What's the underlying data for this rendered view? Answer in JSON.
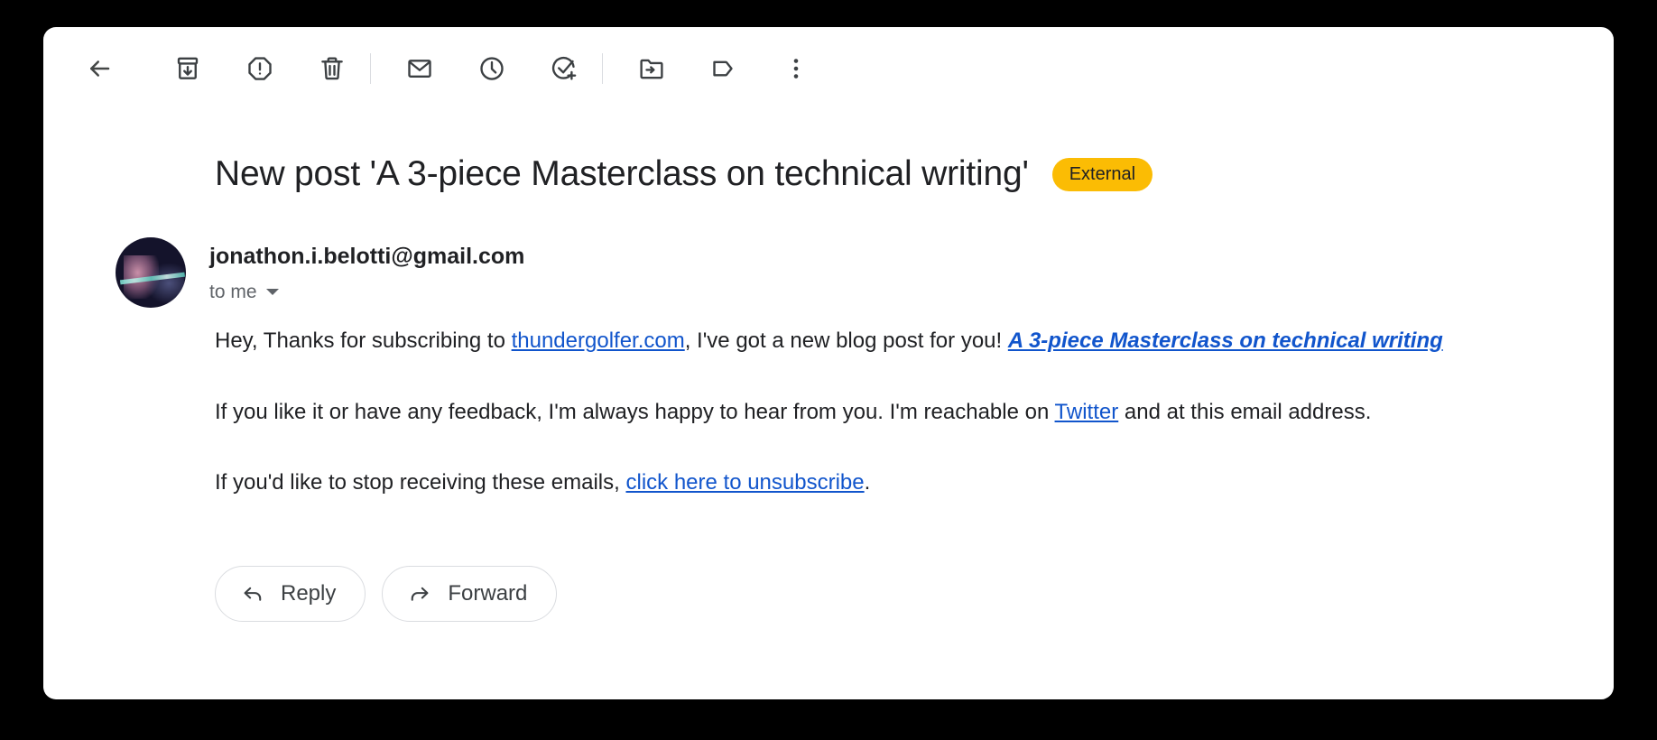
{
  "toolbar": {
    "back_label": "Back",
    "items": [
      {
        "name": "archive",
        "label": "Archive"
      },
      {
        "name": "spam",
        "label": "Report spam"
      },
      {
        "name": "delete",
        "label": "Delete"
      },
      {
        "name": "unread",
        "label": "Mark as unread"
      },
      {
        "name": "snooze",
        "label": "Snooze"
      },
      {
        "name": "add-task",
        "label": "Add to tasks"
      },
      {
        "name": "move-to",
        "label": "Move to"
      },
      {
        "name": "labels",
        "label": "Labels"
      },
      {
        "name": "more",
        "label": "More"
      }
    ]
  },
  "email": {
    "subject": "New post 'A 3-piece Masterclass on technical writing'",
    "badge": "External",
    "badge_color": "#fbbc04",
    "sender": "jonathon.i.belotti@gmail.com",
    "recipient": "to me",
    "link_color": "#1155cc",
    "paragraph1": {
      "before_link": "Hey, Thanks for subscribing to ",
      "link1": "thundergolfer.com",
      "middle": ", I've got a new blog post for you! ",
      "link2": "A 3-piece Masterclass on technical writing"
    },
    "paragraph2": {
      "before_link": "If you like it or have any feedback, I'm always happy to hear from you. I'm reachable on ",
      "link": "Twitter",
      "after_link": " and at this email address."
    },
    "paragraph3": {
      "before_link": "If you'd like to stop receiving these emails, ",
      "link": "click here to unsubscribe",
      "after_link": "."
    }
  },
  "actions": {
    "reply": "Reply",
    "forward": "Forward"
  }
}
